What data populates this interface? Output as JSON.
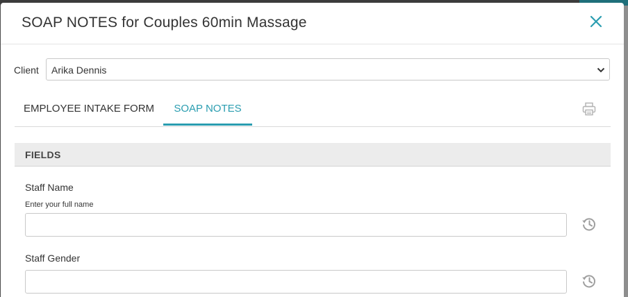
{
  "modal": {
    "title": "SOAP NOTES for Couples 60min Massage",
    "close_icon": "close-icon"
  },
  "client": {
    "label": "Client",
    "selected": "Arika Dennis"
  },
  "tabs": [
    {
      "label": "EMPLOYEE INTAKE FORM",
      "active": false
    },
    {
      "label": "SOAP NOTES",
      "active": true
    }
  ],
  "print_icon": "printer-icon",
  "section": {
    "title": "FIELDS"
  },
  "fields": [
    {
      "label": "Staff Name",
      "hint": "Enter your full name",
      "value": "",
      "icon": "history-icon"
    },
    {
      "label": "Staff Gender",
      "hint": "",
      "value": "",
      "icon": "history-icon"
    }
  ],
  "colors": {
    "accent": "#2a9db0",
    "icon_gray": "#9e9e9e",
    "section_bg": "#ececec"
  }
}
